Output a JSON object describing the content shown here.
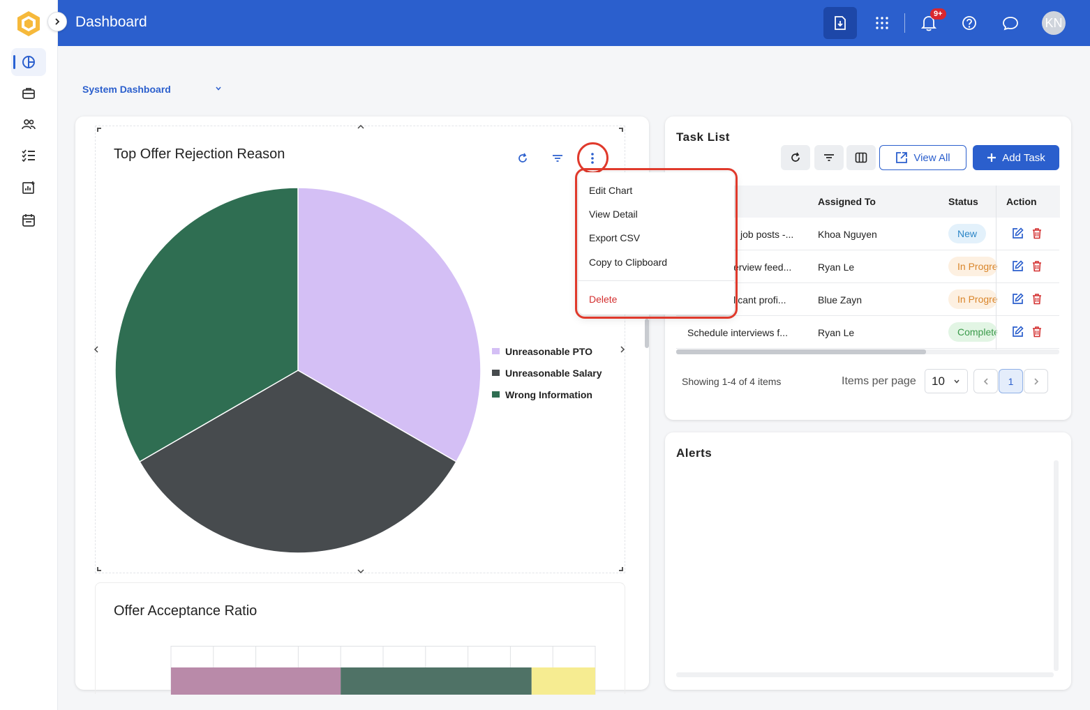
{
  "header": {
    "title": "Dashboard",
    "notification_badge": "9+",
    "avatar_initials": "KN"
  },
  "dashboard_selector": {
    "value": "System Dashboard"
  },
  "chart_widget": {
    "title": "Top Offer Rejection Reason",
    "menu": {
      "items": [
        "Edit Chart",
        "View Detail",
        "Export CSV",
        "Copy to Clipboard"
      ],
      "delete_label": "Delete"
    }
  },
  "chart_data": [
    {
      "type": "pie",
      "title": "Top Offer Rejection Reason",
      "slices": [
        {
          "label": "Unreasonable PTO",
          "value": 33.33,
          "color": "#d4bff5"
        },
        {
          "label": "Unreasonable Salary",
          "value": 33.33,
          "color": "#474b4e"
        },
        {
          "label": "Wrong Information",
          "value": 33.33,
          "color": "#2f6e52"
        }
      ],
      "legend_position": "right"
    },
    {
      "type": "bar",
      "title": "Offer Acceptance Ratio",
      "orientation": "horizontal-stacked",
      "series": [
        {
          "name": "",
          "values": [
            40
          ],
          "color": "#b98aa9"
        },
        {
          "name": "",
          "values": [
            45
          ],
          "color": "#4f7266"
        },
        {
          "name": "",
          "values": [
            15
          ],
          "color": "#f6ec91"
        }
      ],
      "grid": true
    }
  ],
  "acceptance_widget": {
    "title": "Offer Acceptance Ratio"
  },
  "task_list": {
    "title": "Task List",
    "view_all_label": "View All",
    "add_task_label": "Add Task",
    "columns": [
      "Assigned To",
      "Status",
      "Action"
    ],
    "rows": [
      {
        "task": "job posts -...",
        "assigned_to": "Khoa Nguyen",
        "status": "New"
      },
      {
        "task": "erview feed...",
        "assigned_to": "Ryan Le",
        "status": "In Progress"
      },
      {
        "task": "licant profi...",
        "assigned_to": "Blue Zayn",
        "status": "In Progress"
      },
      {
        "task": "Schedule interviews f...",
        "assigned_to": "Ryan Le",
        "status": "Completed"
      }
    ],
    "showing_text": "Showing 1-4 of 4 items",
    "items_per_page_label": "Items per page",
    "items_per_page_value": "10",
    "current_page": "1"
  },
  "alerts": {
    "title": "Alerts"
  },
  "colors": {
    "header_blue": "#2b5fcd",
    "highlight_red": "#e03a2c",
    "delete_red": "#d32f2f"
  }
}
